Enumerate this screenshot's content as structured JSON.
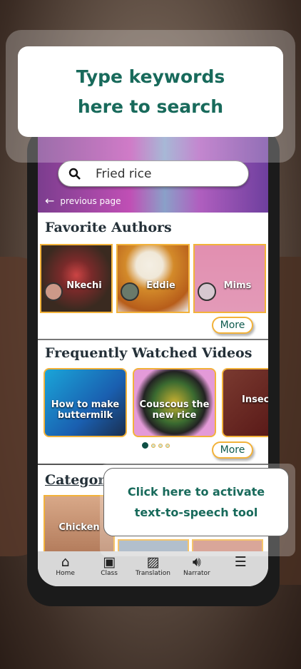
{
  "search": {
    "value": "Fried rice"
  },
  "nav_back": {
    "label": "previous page"
  },
  "favorite_authors": {
    "title": "Favorite Authors",
    "authors": [
      {
        "name": "Nkechi"
      },
      {
        "name": "Eddie"
      },
      {
        "name": "Mims"
      }
    ],
    "more_label": "More"
  },
  "videos": {
    "title": "Frequently Watched Videos",
    "items": [
      {
        "title": "How to make buttermilk"
      },
      {
        "title": "Couscous the new rice"
      },
      {
        "title": "Insec"
      }
    ],
    "more_label": "More",
    "carousel_page": 1,
    "carousel_total": 4
  },
  "categories": {
    "title": "Categor",
    "items": [
      {
        "label": "Chicken"
      }
    ]
  },
  "bottom_nav": [
    {
      "label": "Home",
      "icon": "home-icon"
    },
    {
      "label": "Class",
      "icon": "class-icon"
    },
    {
      "label": "Translation",
      "icon": "translation-icon"
    },
    {
      "label": "Narrator",
      "icon": "speaker-icon"
    },
    {
      "label": "",
      "icon": "menu-icon"
    }
  ],
  "tooltips": {
    "search": "Type keywords here to search",
    "narrator": "Click here to activate text-to-speech tool"
  },
  "colors": {
    "accent": "#f2b23a",
    "brand": "#186a5b"
  }
}
